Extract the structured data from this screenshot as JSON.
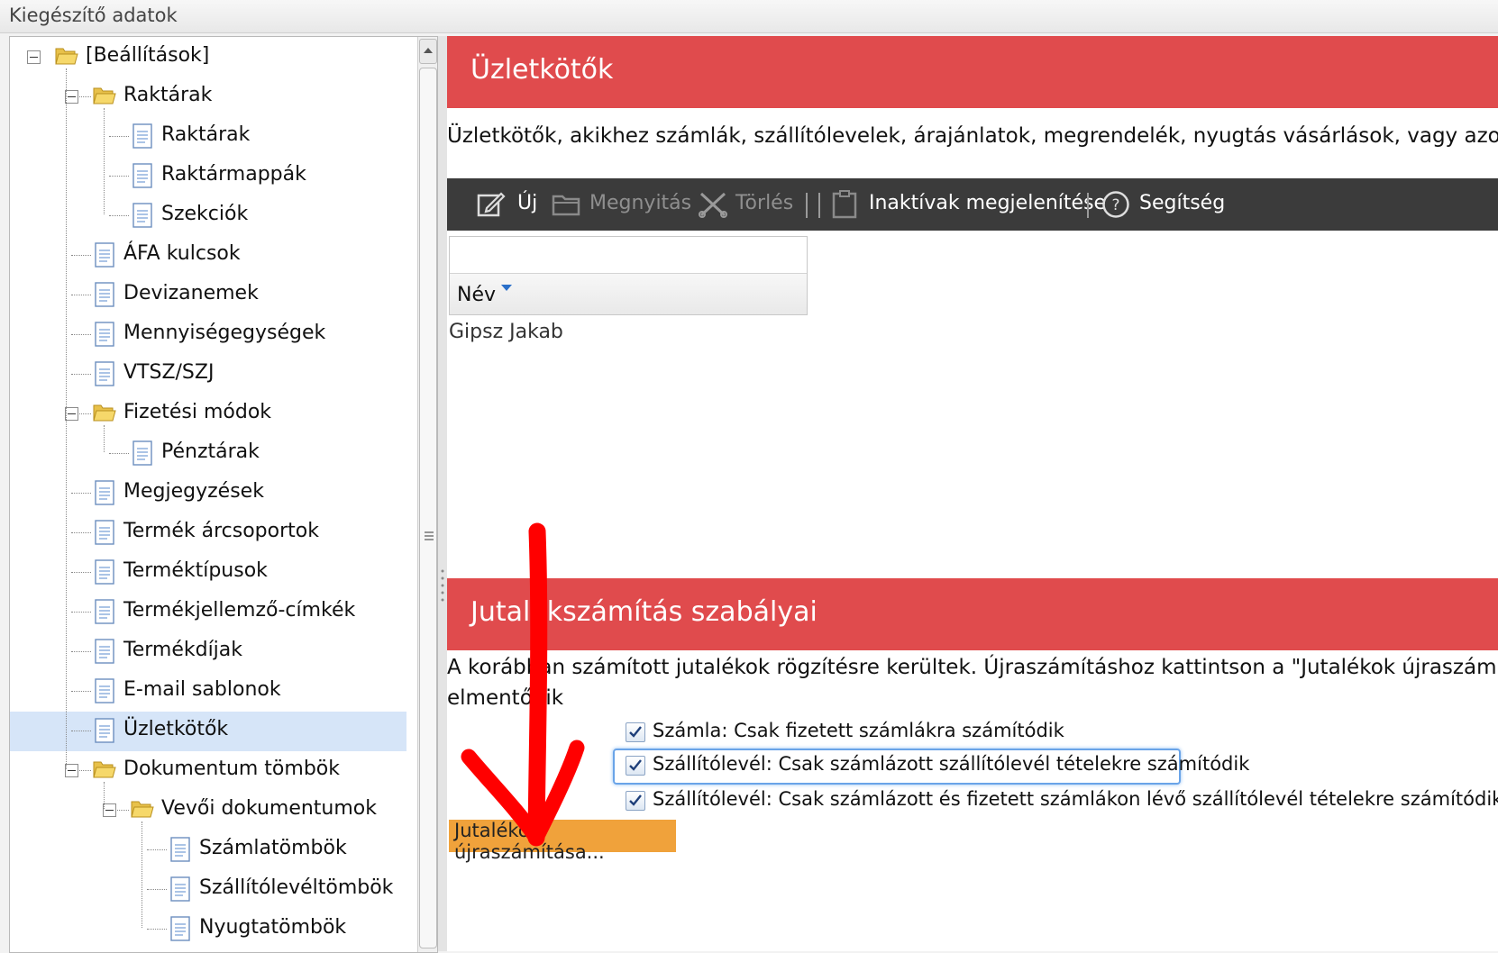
{
  "window": {
    "title": "Kiegészítő adatok"
  },
  "tree": {
    "items": [
      {
        "label": "[Beállítások]",
        "type": "folder",
        "level": 0,
        "expanded": true
      },
      {
        "label": "Raktárak",
        "type": "folder",
        "level": 1,
        "expanded": true
      },
      {
        "label": "Raktárak",
        "type": "page",
        "level": 2
      },
      {
        "label": "Raktármappák",
        "type": "page",
        "level": 2
      },
      {
        "label": "Szekciók",
        "type": "page",
        "level": 2
      },
      {
        "label": "ÁFA kulcsok",
        "type": "page",
        "level": 1
      },
      {
        "label": "Devizanemek",
        "type": "page",
        "level": 1
      },
      {
        "label": "Mennyiségegységek",
        "type": "page",
        "level": 1
      },
      {
        "label": "VTSZ/SZJ",
        "type": "page",
        "level": 1
      },
      {
        "label": "Fizetési módok",
        "type": "folder",
        "level": 1,
        "expanded": true
      },
      {
        "label": "Pénztárak",
        "type": "page",
        "level": 2
      },
      {
        "label": "Megjegyzések",
        "type": "page",
        "level": 1
      },
      {
        "label": "Termék árcsoportok",
        "type": "page",
        "level": 1
      },
      {
        "label": "Terméktípusok",
        "type": "page",
        "level": 1
      },
      {
        "label": "Termékjellemző-címkék",
        "type": "page",
        "level": 1
      },
      {
        "label": "Termékdíjak",
        "type": "page",
        "level": 1
      },
      {
        "label": "E-mail sablonok",
        "type": "page",
        "level": 1
      },
      {
        "label": "Üzletkötők",
        "type": "page",
        "level": 1,
        "selected": true
      },
      {
        "label": "Dokumentum tömbök",
        "type": "folder",
        "level": 1,
        "expanded": true
      },
      {
        "label": "Vevői dokumentumok",
        "type": "folder",
        "level": 2,
        "expanded": true
      },
      {
        "label": "Számlatömbök",
        "type": "page",
        "level": 3
      },
      {
        "label": "Szállítólevéltömbök",
        "type": "page",
        "level": 3
      },
      {
        "label": "Nyugtatömbök",
        "type": "page",
        "level": 3
      }
    ]
  },
  "section1": {
    "title": "Üzletkötők",
    "description": "Üzletkötők, akikhez számlák, szállítólevelek, árajánlatok, megrendelék, nyugtás vásárlások, vagy azo"
  },
  "toolbar": {
    "new_label": "Új",
    "open_label": "Megnyitás",
    "delete_label": "Törlés",
    "inactive_label": "Inaktívak megjelenítése",
    "help_label": "Segítség"
  },
  "grid": {
    "column_header": "Név",
    "rows": [
      "Gipsz Jakab"
    ]
  },
  "section2": {
    "title": "Jutalékszámítás szabályai",
    "description_line1": "A korábban számított jutalékok rögzítésre kerültek. Újraszámításhoz kattintson a \"Jutalékok újraszám",
    "description_line2": "elmentődik",
    "checkboxes": [
      {
        "label": "Számla: Csak fizetett számlákra számítódik",
        "checked": true
      },
      {
        "label": "Szállítólevél: Csak számlázott szállítólevél tételekre számítódik",
        "checked": true,
        "focused": true
      },
      {
        "label": "Szállítólevél: Csak számlázott és fizetett számlákon lévő szállítólevél tételekre számítódik",
        "checked": true
      }
    ],
    "recalc_button": "Jutalékok újraszámítása..."
  },
  "colors": {
    "header_red": "#e04b4d",
    "toolbar_dark": "#3b3b3b",
    "selection_blue": "#d6e5f8",
    "button_orange": "#f0a23b",
    "annotation_arrow": "#ff0000"
  }
}
